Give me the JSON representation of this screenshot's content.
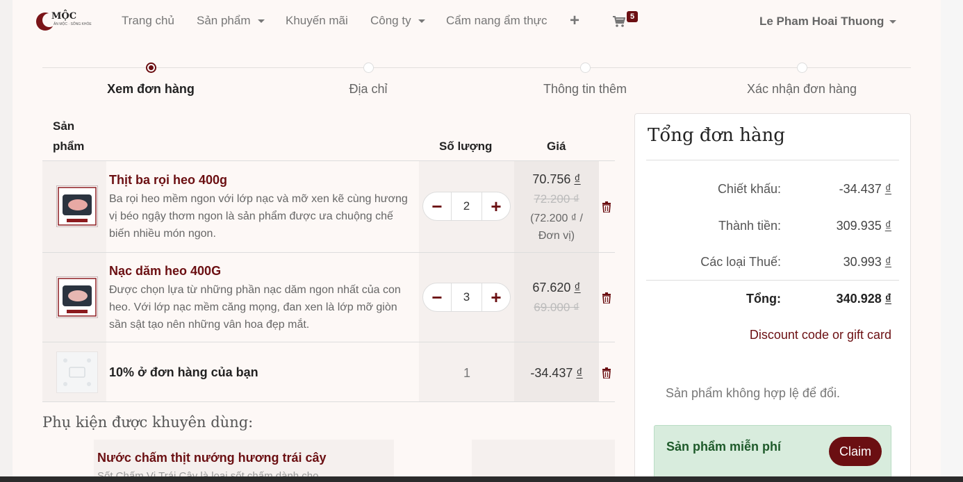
{
  "brand": {
    "name": "MỘC",
    "tagline": "ĂN MỘC · SỐNG KHỎE",
    "accent": "#6b0f12"
  },
  "nav": {
    "items": [
      {
        "label": "Trang chủ",
        "dropdown": false
      },
      {
        "label": "Sản phẩm",
        "dropdown": true
      },
      {
        "label": "Khuyến mãi",
        "dropdown": false
      },
      {
        "label": "Công ty",
        "dropdown": true
      },
      {
        "label": "Cẩm nang ẩm thực",
        "dropdown": false
      }
    ],
    "cart_count": "5",
    "user_name": "Le Pham Hoai Thuong"
  },
  "steps": [
    {
      "label": "Xem đơn hàng",
      "active": true
    },
    {
      "label": "Địa chỉ",
      "active": false
    },
    {
      "label": "Thông tin thêm",
      "active": false
    },
    {
      "label": "Xác nhận đơn hàng",
      "active": false
    }
  ],
  "table": {
    "headers": {
      "product_line1": "Sản",
      "product_line2": "phẩm",
      "quantity": "Số lượng",
      "price": "Giá"
    },
    "rows": [
      {
        "name": "Thịt ba rọi heo 400g",
        "description": "Ba rọi heo mềm ngon với lớp nạc và mỡ xen kẽ cùng hương vị béo ngậy thơm ngon là sản phẩm được ưa chuộng chế biến nhiều món ngon.",
        "quantity": "2",
        "price": "70.756",
        "old_price": "72.200 ₫",
        "unit_price_line1": "(72.200 ₫ /",
        "unit_price_line2": "Đơn vị)",
        "currency": "₫"
      },
      {
        "name": "Nạc dăm heo 400G",
        "description": "Được chọn lựa từ những phần nạc dăm ngon nhất của con heo. Với lớp nạc mềm căng mọng, đan xen là lớp mỡ giòn sần sật tạo nên những vân hoa đẹp mắt.",
        "quantity": "3",
        "price": "67.620",
        "old_price": "69.000 ₫",
        "currency": "₫"
      },
      {
        "name": "10% ở đơn hàng của bạn",
        "quantity": "1",
        "price": "-34.437",
        "currency": "₫"
      }
    ]
  },
  "accessories": {
    "title": "Phụ kiện được khuyên dùng:",
    "item_name": "Nước chấm thịt nướng hương trái cây",
    "item_desc": "Sốt Chấm Vị Trái Cây là loại sốt chấm dành cho"
  },
  "summary": {
    "title": "Tổng đơn hàng",
    "discount_label": "Chiết khấu:",
    "discount_value": "-34.437",
    "subtotal_label": "Thành tiền:",
    "subtotal_value": "309.935",
    "tax_label": "Các loại Thuế:",
    "tax_value": "30.993",
    "total_label": "Tổng:",
    "total_value": "340.928",
    "currency": "₫",
    "discount_link": "Discount code or gift card",
    "invalid_msg": "Sản phẩm không hợp lệ để đổi.",
    "free_title": "Sản phẩm miễn phí",
    "claim_label": "Claim"
  }
}
